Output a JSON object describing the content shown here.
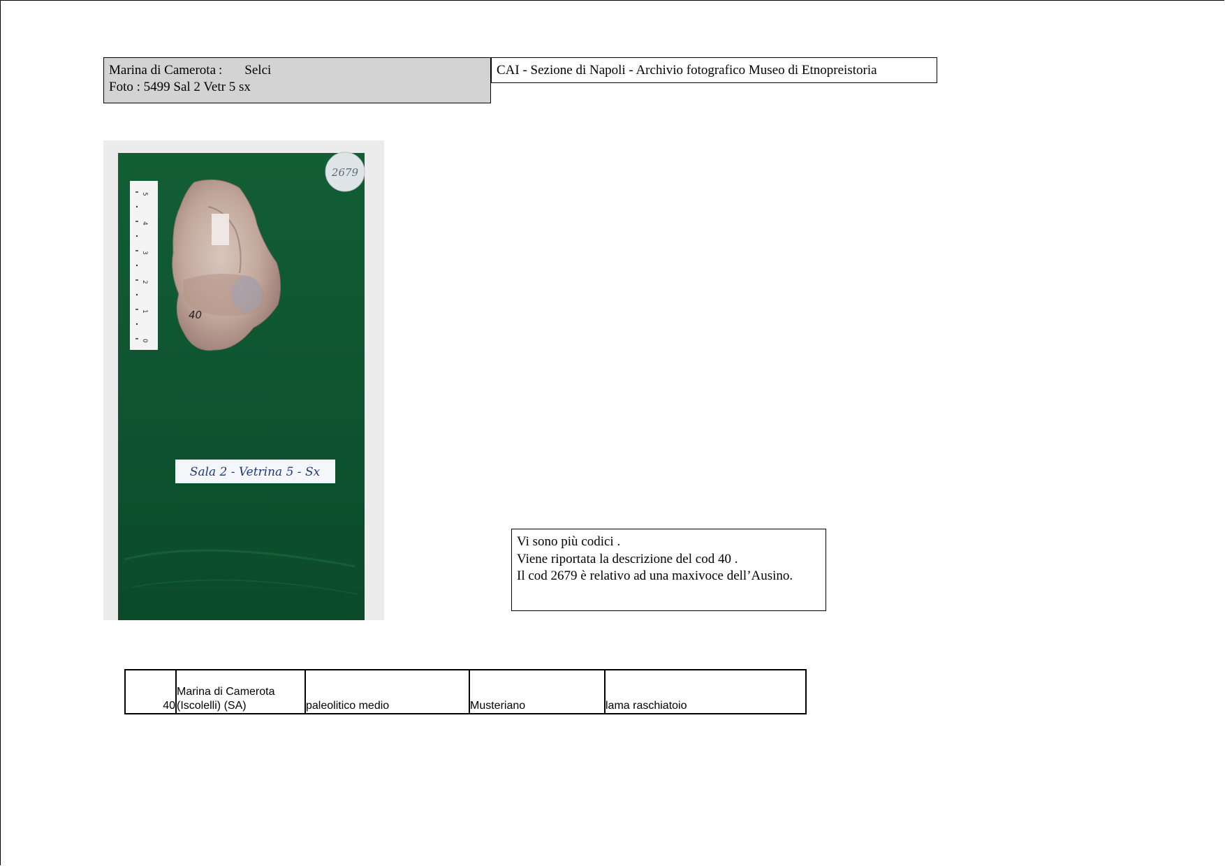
{
  "header": {
    "location": "Marina di Camerota",
    "separator": ":",
    "category": "Selci",
    "photo_ref": "Foto : 5499  Sal 2 Vetr 5 sx",
    "archive_title": "CAI - Sezione di Napoli  - Archivio fotografico Museo di Etnopreistoria"
  },
  "photo": {
    "tag_number": "2679",
    "object_code": "40",
    "display_label": "Sala 2 - Vetrina 5 - Sx",
    "ruler_marks": [
      "0",
      "1",
      "2",
      "3",
      "4",
      "5"
    ],
    "colors": {
      "board": "#0f5a32",
      "stone": "#c9b3a8",
      "background": "#ececec"
    }
  },
  "note": {
    "lines": [
      "Vi sono più codici .",
      "Viene riportata la descrizione del cod 40 .",
      "Il cod 2679 è relativo ad una maxivoce dell’Ausino."
    ]
  },
  "record": {
    "code": "40",
    "location_line1": "Marina di Camerota",
    "location_line2": "(Iscolelli) (SA)",
    "period": "paleolitico medio",
    "culture": "Musteriano",
    "type": "lama raschiatoio"
  }
}
